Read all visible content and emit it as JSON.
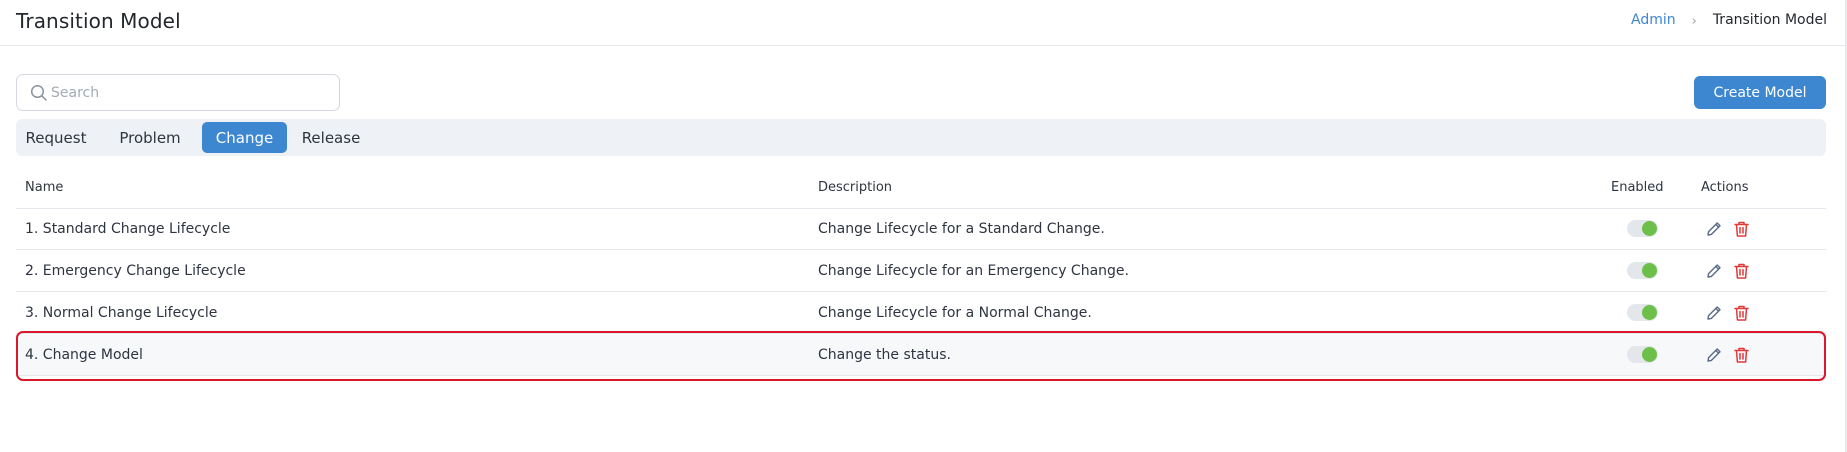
{
  "header": {
    "title": "Transition Model",
    "breadcrumb": {
      "parent": "Admin",
      "separator": "›",
      "current": "Transition Model"
    }
  },
  "search": {
    "placeholder": "Search",
    "value": ""
  },
  "actions": {
    "create_label": "Create Model"
  },
  "tabs": [
    {
      "label": "Request",
      "active": false
    },
    {
      "label": "Problem",
      "active": false
    },
    {
      "label": "Change",
      "active": true
    },
    {
      "label": "Release",
      "active": false
    }
  ],
  "table": {
    "columns": {
      "name": "Name",
      "description": "Description",
      "enabled": "Enabled",
      "actions": "Actions"
    },
    "rows": [
      {
        "name": "1. Standard Change Lifecycle",
        "description": "Change Lifecycle for a Standard Change.",
        "enabled": true
      },
      {
        "name": "2. Emergency Change Lifecycle",
        "description": "Change Lifecycle for an Emergency Change.",
        "enabled": true
      },
      {
        "name": "3. Normal Change Lifecycle",
        "description": "Change Lifecycle for a Normal Change.",
        "enabled": true
      },
      {
        "name": "4. Change Model",
        "description": "Change the status.",
        "enabled": true,
        "highlighted": true
      }
    ]
  },
  "icons": {
    "search": "search-icon",
    "edit": "pencil-icon",
    "delete": "trash-icon"
  },
  "colors": {
    "accent": "#3d87d1",
    "toggle_on": "#6cc04a",
    "delete": "#e0393a",
    "highlight_border": "#d9182a"
  }
}
